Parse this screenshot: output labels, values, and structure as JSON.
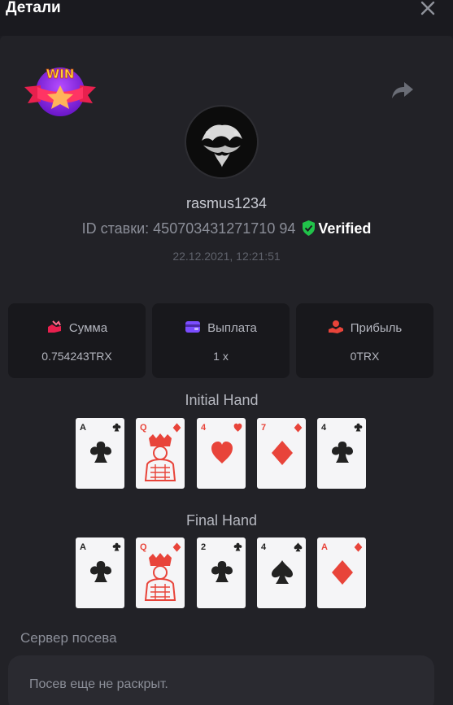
{
  "header": {
    "title": "Детали"
  },
  "badge": {
    "text": "WIN"
  },
  "user": {
    "username": "rasmus1234",
    "bet_id_label": "ID ставки:",
    "bet_id": "450703431271710 94",
    "verified": "Verified",
    "datetime": "22.12.2021, 12:21:51"
  },
  "stats": [
    {
      "label": "Сумма",
      "value": "0.754243TRX",
      "icon": "amount-icon"
    },
    {
      "label": "Выплата",
      "value": "1 x",
      "icon": "wallet-icon"
    },
    {
      "label": "Прибыль",
      "value": "0TRX",
      "icon": "profit-icon"
    }
  ],
  "hands": {
    "initial_title": "Initial Hand",
    "final_title": "Final Hand",
    "initial": [
      {
        "rank": "A",
        "suit": "clubs"
      },
      {
        "rank": "Q",
        "suit": "diamonds"
      },
      {
        "rank": "4",
        "suit": "hearts"
      },
      {
        "rank": "7",
        "suit": "diamonds"
      },
      {
        "rank": "4",
        "suit": "clubs"
      }
    ],
    "final": [
      {
        "rank": "A",
        "suit": "clubs"
      },
      {
        "rank": "Q",
        "suit": "diamonds"
      },
      {
        "rank": "2",
        "suit": "clubs"
      },
      {
        "rank": "4",
        "suit": "spades"
      },
      {
        "rank": "A",
        "suit": "diamonds"
      }
    ]
  },
  "seed": {
    "title": "Сервер посева",
    "message": "Посев еще не раскрыт."
  },
  "colors": {
    "verified": "#21c34a",
    "accent_red": "#e8443a",
    "wallet": "#7b4dff"
  }
}
